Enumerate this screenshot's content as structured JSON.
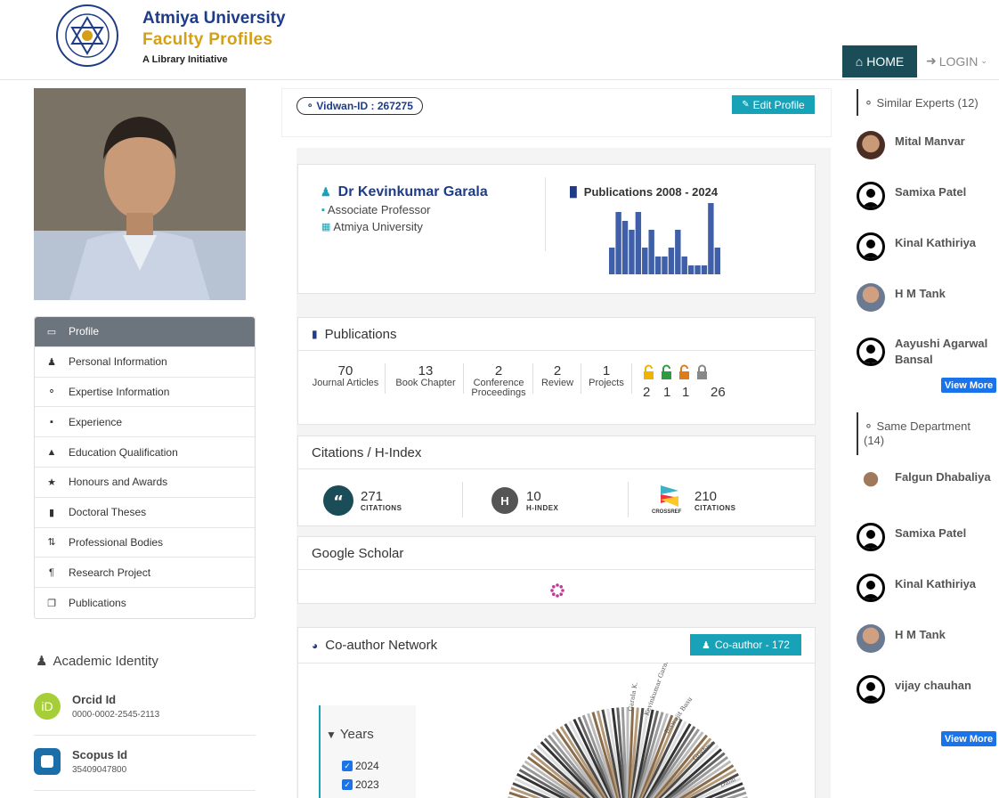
{
  "header": {
    "title": "Atmiya University",
    "subtitle": "Faculty Profiles",
    "tagline": "A Library Initiative",
    "nav": {
      "home": "HOME",
      "login": "LOGIN"
    }
  },
  "profile": {
    "vidwan_id": "Vidwan-ID : 267275",
    "edit_label": "Edit Profile",
    "name": "Dr Kevinkumar Garala",
    "designation": "Associate Professor",
    "institution": "Atmiya University",
    "pub_chart_title": "Publications 2008 - 2024"
  },
  "sidebar_menu": [
    {
      "label": "Profile",
      "icon": "monitor-icon"
    },
    {
      "label": "Personal Information",
      "icon": "user-icon"
    },
    {
      "label": "Expertise Information",
      "icon": "bulb-icon"
    },
    {
      "label": "Experience",
      "icon": "briefcase-icon"
    },
    {
      "label": "Education Qualification",
      "icon": "graduation-cap-icon"
    },
    {
      "label": "Honours and Awards",
      "icon": "trophy-icon"
    },
    {
      "label": "Doctoral Theses",
      "icon": "book-icon"
    },
    {
      "label": "Professional Bodies",
      "icon": "sort-icon"
    },
    {
      "label": "Research Project",
      "icon": "paragraph-icon"
    },
    {
      "label": "Publications",
      "icon": "copy-icon"
    }
  ],
  "academic_identity": {
    "title": "Academic Identity",
    "orcid": {
      "label": "Orcid Id",
      "value": "0000-0002-2545-2113"
    },
    "scopus": {
      "label": "Scopus Id",
      "value": "35409047800"
    }
  },
  "publications": {
    "title": "Publications",
    "stats": [
      {
        "num": "70",
        "label": "Journal Articles"
      },
      {
        "num": "13",
        "label": "Book Chapter"
      },
      {
        "num": "2",
        "label": "Conference Proceedings"
      },
      {
        "num": "2",
        "label": "Review"
      },
      {
        "num": "1",
        "label": "Projects"
      }
    ],
    "access": [
      {
        "num": "2",
        "color": "#f0b400"
      },
      {
        "num": "1",
        "color": "#2e9b3e"
      },
      {
        "num": "1",
        "color": "#e07b1a"
      },
      {
        "num": "26",
        "color": "#888888"
      }
    ]
  },
  "citations": {
    "title": "Citations / H-Index",
    "citations": {
      "num": "271",
      "label": "CITATIONS"
    },
    "hindex": {
      "num": "10",
      "label": "H-INDEX",
      "badge": "H"
    },
    "crossref": {
      "num": "210",
      "label": "CITATIONS",
      "brand": "CROSSREF"
    }
  },
  "google_scholar": {
    "title": "Google Scholar"
  },
  "coauthor": {
    "title": "Co-author Network",
    "button": "Co-author - 172",
    "years_title": "Years",
    "years": [
      "2024",
      "2023"
    ]
  },
  "chart_data": {
    "type": "bar",
    "title": "Publications 2008 - 2024",
    "values": [
      3,
      7,
      6,
      5,
      7,
      3,
      5,
      2,
      2,
      3,
      5,
      2,
      1,
      1,
      1,
      8,
      3
    ],
    "mode": "sparkline"
  },
  "similar_experts": {
    "title": "Similar Experts (12)",
    "people": [
      {
        "name": "Mital Manvar",
        "avatar": "photo"
      },
      {
        "name": "Samixa Patel",
        "avatar": "icon"
      },
      {
        "name": "Kinal Kathiriya",
        "avatar": "icon"
      },
      {
        "name": "H M Tank",
        "avatar": "photo"
      },
      {
        "name": "Aayushi Agarwal Bansal",
        "avatar": "icon"
      }
    ],
    "view_more": "View More"
  },
  "same_department": {
    "title": "Same Department (14)",
    "people": [
      {
        "name": "Falgun Dhabaliya",
        "avatar": "photo"
      },
      {
        "name": "Samixa Patel",
        "avatar": "icon"
      },
      {
        "name": "Kinal Kathiriya",
        "avatar": "icon"
      },
      {
        "name": "H M Tank",
        "avatar": "photo"
      },
      {
        "name": "vijay chauhan",
        "avatar": "icon"
      }
    ],
    "view_more": "View More"
  }
}
